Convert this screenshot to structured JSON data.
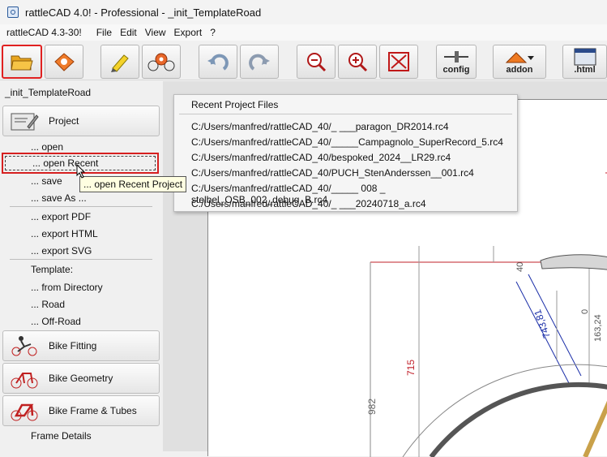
{
  "window": {
    "title": "rattleCAD 4.0! - Professional  - _init_TemplateRoad"
  },
  "menubar": {
    "version": "rattleCAD 4.3-30!",
    "items": [
      "File",
      "Edit",
      "View",
      "Export",
      "?"
    ]
  },
  "toolbar": {
    "config_label": "config",
    "addon_label": "addon",
    "html_label": ".html"
  },
  "sidebar": {
    "crumb": "_init_TemplateRoad",
    "project": "Project",
    "open": "... open",
    "open_recent": "... open Recent",
    "save": "... save",
    "save_as": "... save As ...",
    "export_pdf": "... export PDF",
    "export_html": "... export HTML",
    "export_svg": "... export SVG",
    "template": "Template:",
    "from_directory": "... from Directory",
    "road": "... Road",
    "off_road": "... Off-Road",
    "bike_fitting": "Bike Fitting",
    "bike_geometry": "Bike Geometry",
    "bike_frame": "Bike Frame & Tubes",
    "frame_details": "Frame Details"
  },
  "tooltip": "... open Recent Project",
  "recent": {
    "header": "Recent Project Files",
    "files": [
      "C:/Users/manfred/rattleCAD_40/_ ___paragon_DR2014.rc4",
      "C:/Users/manfred/rattleCAD_40/_____Campagnolo_SuperRecord_5.rc4",
      "C:/Users/manfred/rattleCAD_40/bespoked_2024__LR29.rc4",
      "C:/Users/manfred/rattleCAD_40/PUCH_StenAnderssen__001.rc4",
      "C:/Users/manfred/rattleCAD_40/_____ 008 _ stelbel_OSB_002_debug_B.rc4",
      "C:/Users/manfred/rattleCAD_40/_ ___20240718_a.rc4"
    ]
  },
  "drawing": {
    "dim_40": "40",
    "dim_0": "0",
    "dim_1632": "163,24",
    "dim_74381": "743,81",
    "dim_715": "715",
    "dim_982": "982"
  },
  "colors": {
    "highlight": "#e02020",
    "tooltip_bg": "#ffffe1",
    "dimension_blue": "#1a2ea8",
    "frame_red": "#c0202a"
  }
}
